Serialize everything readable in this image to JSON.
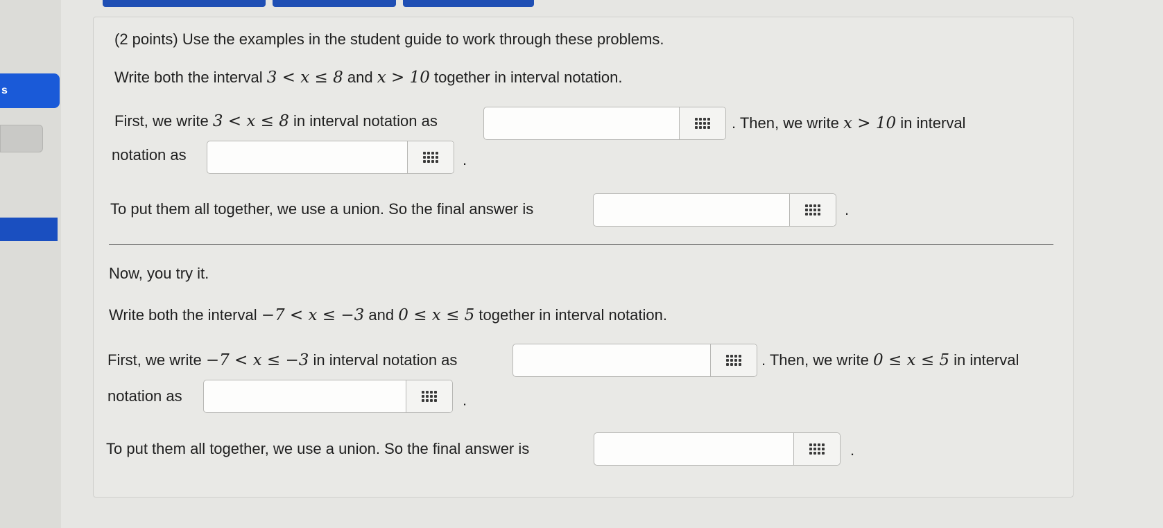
{
  "sidebar": {
    "blue_button_label": "s"
  },
  "problem": {
    "header": "(2 points) Use the examples in the student guide to work through these problems.",
    "example": {
      "intro_pre": "Write both the interval",
      "interval1": "3 < x ≤ 8",
      "and": "and",
      "interval2": "x > 10",
      "intro_post": "together in interval notation.",
      "first_pre": "First, we write",
      "first_post": "in interval notation as",
      "then_pre": ". Then, we write",
      "then_post": "in interval",
      "notation_as": "notation as",
      "union_text": "To put them all together, we use a union. So the final answer is",
      "period": "."
    },
    "practice": {
      "now_try": "Now, you try it.",
      "intro_pre": "Write both the interval",
      "interval1": "−7 < x ≤ −3",
      "and": "and",
      "interval2": "0 ≤ x ≤ 5",
      "intro_post": "together in interval notation.",
      "first_pre": "First, we write",
      "first_post": "in interval notation as",
      "then_pre": ". Then, we write",
      "then_post": "in interval",
      "notation_as": "notation as",
      "union_text": "To put them all together, we use a union. So the final answer is",
      "period": "."
    },
    "answers": {
      "example_interval1": "",
      "example_interval2": "",
      "example_union": "",
      "practice_interval1": "",
      "practice_interval2": "",
      "practice_union": ""
    }
  },
  "icons": {
    "keypad": "keypad-grid-icon"
  }
}
